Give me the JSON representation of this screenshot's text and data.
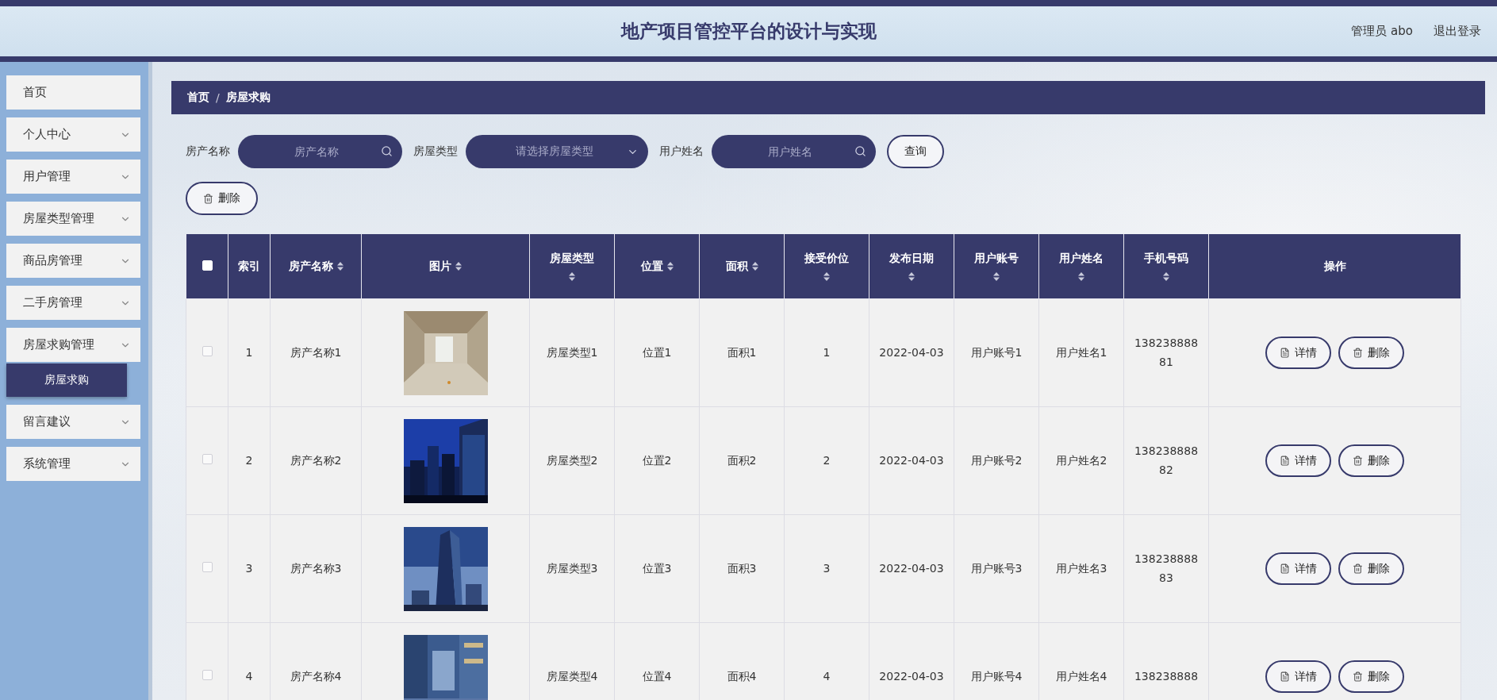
{
  "header": {
    "title": "地产项目管控平台的设计与实现",
    "user": "管理员 abo",
    "logout": "退出登录"
  },
  "sidebar": {
    "items": [
      {
        "label": "首页",
        "kind": "link"
      },
      {
        "label": "个人中心",
        "kind": "menu"
      },
      {
        "label": "用户管理",
        "kind": "menu"
      },
      {
        "label": "房屋类型管理",
        "kind": "menu"
      },
      {
        "label": "商品房管理",
        "kind": "menu"
      },
      {
        "label": "二手房管理",
        "kind": "menu"
      },
      {
        "label": "房屋求购管理",
        "kind": "menu",
        "children": [
          {
            "label": "房屋求购",
            "selected": true
          }
        ]
      },
      {
        "label": "留言建议",
        "kind": "menu"
      },
      {
        "label": "系统管理",
        "kind": "menu"
      }
    ]
  },
  "breadcrumb": {
    "items": [
      "首页",
      "房屋求购"
    ],
    "separator": "/"
  },
  "filters": [
    {
      "label": "房产名称",
      "kind": "input",
      "placeholder": "房产名称"
    },
    {
      "label": "房屋类型",
      "kind": "select",
      "placeholder": "请选择房屋类型"
    },
    {
      "label": "用户姓名",
      "kind": "input",
      "placeholder": "用户姓名"
    }
  ],
  "search_button": "查询",
  "delete_button": "删除",
  "table": {
    "select_all_checked": false,
    "columns": [
      {
        "kind": "checkbox"
      },
      {
        "label": "索引",
        "kind": "plain"
      },
      {
        "label": "房产名称",
        "kind": "sort"
      },
      {
        "label": "图片",
        "kind": "sort"
      },
      {
        "label": "房屋类型",
        "kind": "sort-stacked"
      },
      {
        "label": "位置",
        "kind": "sort"
      },
      {
        "label": "面积",
        "kind": "sort"
      },
      {
        "label": "接受价位",
        "kind": "sort-stacked"
      },
      {
        "label": "发布日期",
        "kind": "sort-stacked"
      },
      {
        "label": "用户账号",
        "kind": "sort-stacked"
      },
      {
        "label": "用户姓名",
        "kind": "sort-stacked"
      },
      {
        "label": "手机号码",
        "kind": "sort-stacked"
      },
      {
        "label": "操作",
        "kind": "plain"
      }
    ],
    "rows": [
      {
        "checked": false,
        "index": "1",
        "name": "房产名称1",
        "type": "房屋类型1",
        "location": "位置1",
        "area": "面积1",
        "price": "1",
        "date": "2022-04-03",
        "account": "用户账号1",
        "username": "用户姓名1",
        "phone": "13823888881",
        "actions": [
          {
            "label": "详情",
            "kind": "detail"
          },
          {
            "label": "删除",
            "kind": "delete"
          }
        ]
      },
      {
        "checked": false,
        "index": "2",
        "name": "房产名称2",
        "type": "房屋类型2",
        "location": "位置2",
        "area": "面积2",
        "price": "2",
        "date": "2022-04-03",
        "account": "用户账号2",
        "username": "用户姓名2",
        "phone": "13823888882",
        "actions": [
          {
            "label": "详情",
            "kind": "detail"
          },
          {
            "label": "删除",
            "kind": "delete"
          }
        ]
      },
      {
        "checked": false,
        "index": "3",
        "name": "房产名称3",
        "type": "房屋类型3",
        "location": "位置3",
        "area": "面积3",
        "price": "3",
        "date": "2022-04-03",
        "account": "用户账号3",
        "username": "用户姓名3",
        "phone": "13823888883",
        "actions": [
          {
            "label": "详情",
            "kind": "detail"
          },
          {
            "label": "删除",
            "kind": "delete"
          }
        ]
      },
      {
        "checked": false,
        "index": "4",
        "name": "房产名称4",
        "type": "房屋类型4",
        "location": "位置4",
        "area": "面积4",
        "price": "4",
        "date": "2022-04-03",
        "account": "用户账号4",
        "username": "用户姓名4",
        "phone": "138238888",
        "actions": [
          {
            "label": "详情",
            "kind": "detail"
          },
          {
            "label": "删除",
            "kind": "delete"
          }
        ]
      }
    ]
  }
}
